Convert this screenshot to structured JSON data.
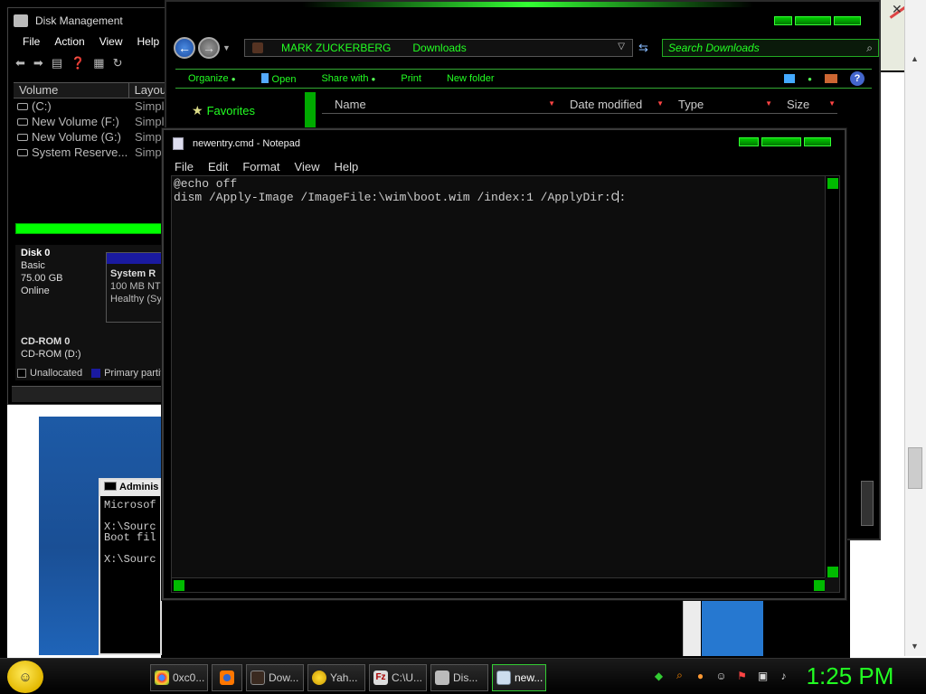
{
  "disk_management": {
    "title": "Disk Management",
    "menu": [
      "File",
      "Action",
      "View",
      "Help"
    ],
    "columns": [
      "Volume",
      "Layou"
    ],
    "volumes": [
      {
        "name": "(C:)",
        "layout": "Simpl"
      },
      {
        "name": "New Volume (F:)",
        "layout": "Simpl"
      },
      {
        "name": "New Volume (G:)",
        "layout": "Simp"
      },
      {
        "name": "System Reserve...",
        "layout": "Simp"
      }
    ],
    "disk0": {
      "name": "Disk 0",
      "type": "Basic",
      "size": "75.00 GB",
      "status": "Online"
    },
    "system_reserved": {
      "name": "System R",
      "size": "100 MB NT",
      "health": "Healthy (Sy"
    },
    "cdrom": {
      "name": "CD-ROM 0",
      "drive": "CD-ROM (D:)"
    },
    "legend": {
      "unallocated": "Unallocated",
      "primary": "Primary partiti"
    }
  },
  "cmd": {
    "title": "Adminis",
    "lines": [
      "Microsof",
      "",
      "X:\\Sourc",
      "Boot fil",
      "",
      "X:\\Sourc"
    ]
  },
  "explorer": {
    "breadcrumb": [
      "MARK ZUCKERBERG",
      "Downloads"
    ],
    "search_placeholder": "Search Downloads",
    "commands": [
      "Organize",
      "Open",
      "Share with",
      "Print",
      "New folder"
    ],
    "nav_favorites": "Favorites",
    "columns": [
      "Name",
      "Date modified",
      "Type",
      "Size"
    ]
  },
  "notepad": {
    "title": "newentry.cmd - Notepad",
    "menu": [
      "File",
      "Edit",
      "Format",
      "View",
      "Help"
    ],
    "line1": "@echo off",
    "line2_before_caret": "dism /Apply-Image /ImageFile:\\wim\\boot.wim /index:1 /ApplyDir:C",
    "line2_after_caret": ":"
  },
  "taskbar": {
    "items": [
      {
        "label": "0xc0...",
        "icon": "chrome-icon"
      },
      {
        "label": "",
        "icon": "firefox-icon"
      },
      {
        "label": "Dow...",
        "icon": "downloads-folder-icon"
      },
      {
        "label": "Yah...",
        "icon": "yahoo-messenger-icon"
      },
      {
        "label": "C:\\U...",
        "icon": "filezilla-icon"
      },
      {
        "label": "Dis...",
        "icon": "disk-management-icon"
      },
      {
        "label": "new...",
        "icon": "notepad-icon"
      }
    ],
    "clock": "1:25 PM"
  },
  "theme": {
    "accent": "#22ff22",
    "window_bg": "#000000"
  }
}
